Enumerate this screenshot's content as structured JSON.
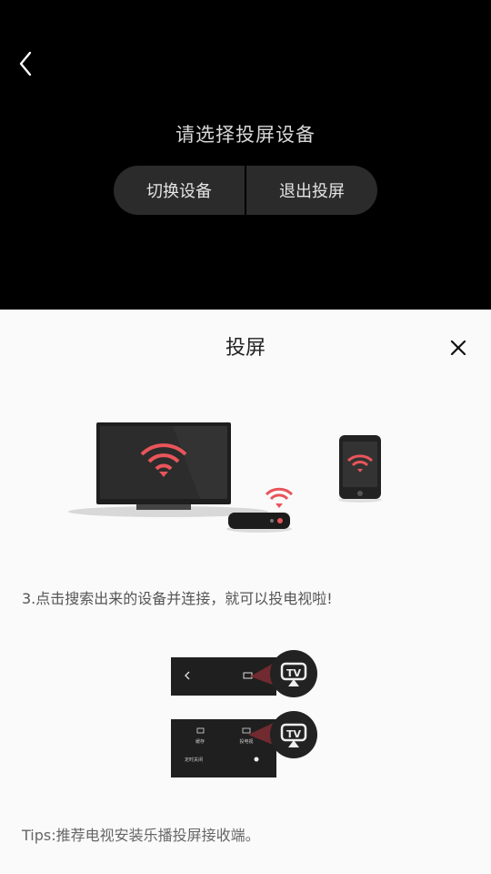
{
  "header": {
    "back_icon": "chevron-left-icon",
    "title": "请选择投屏设备",
    "switch_device_label": "切换设备",
    "exit_cast_label": "退出投屏"
  },
  "sheet": {
    "title": "投屏",
    "close_icon": "close-icon",
    "step_text": "3.点击搜索出来的设备并连接，就可以投电视啦!",
    "guide_screens": {
      "card1_tv_label": "TV",
      "card2_left_label": "缓存",
      "card2_right_label": "投电视",
      "card2_bottom_label": "定时关闭",
      "card2_tv_label": "TV"
    },
    "tips": "Tips:推荐电视安装乐播投屏接收端。"
  },
  "colors": {
    "accent_wifi": "#e8555a",
    "dark_bg": "#000000",
    "sheet_bg": "#fafafa"
  }
}
